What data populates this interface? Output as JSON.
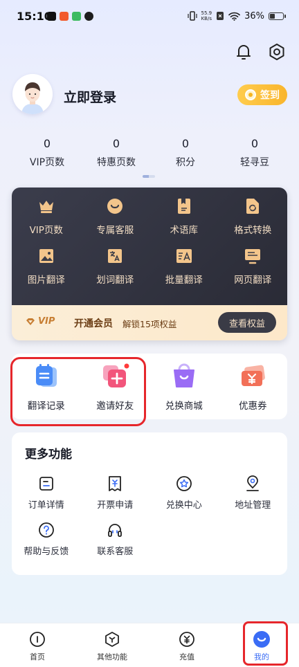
{
  "status_bar": {
    "time": "15:10",
    "net_speed_value": "55.9",
    "net_speed_unit": "KB/s",
    "battery": "36%",
    "battery_level": 0.36
  },
  "profile": {
    "login_label": "立即登录",
    "checkin_label": "签到"
  },
  "stats": [
    {
      "value": "0",
      "label": "VIP页数"
    },
    {
      "value": "0",
      "label": "特惠页数"
    },
    {
      "value": "0",
      "label": "积分"
    },
    {
      "value": "0",
      "label": "轻寻豆"
    }
  ],
  "vip_grid": [
    {
      "label": "VIP页数",
      "icon": "crown-icon"
    },
    {
      "label": "专属客服",
      "icon": "service-icon"
    },
    {
      "label": "术语库",
      "icon": "book-icon"
    },
    {
      "label": "格式转换",
      "icon": "convert-icon"
    },
    {
      "label": "图片翻译",
      "icon": "image-icon"
    },
    {
      "label": "划词翻译",
      "icon": "text-translate-icon"
    },
    {
      "label": "批量翻译",
      "icon": "batch-icon"
    },
    {
      "label": "网页翻译",
      "icon": "webpage-icon"
    }
  ],
  "vip_bar": {
    "badge": "VIP",
    "title": "开通会员",
    "subtitle": "解锁15项权益",
    "button": "查看权益"
  },
  "quick_tools": [
    {
      "label": "翻译记录",
      "icon": "record-icon",
      "color": "#4a8cf7"
    },
    {
      "label": "邀请好友",
      "icon": "invite-icon",
      "color": "#f2557b"
    },
    {
      "label": "兑换商城",
      "icon": "shop-icon",
      "color": "#9a6cf5"
    },
    {
      "label": "优惠券",
      "icon": "coupon-icon",
      "color": "#f27058"
    }
  ],
  "more": {
    "title": "更多功能",
    "items": [
      {
        "label": "订单详情",
        "icon": "order-icon"
      },
      {
        "label": "开票申请",
        "icon": "invoice-icon"
      },
      {
        "label": "兑换中心",
        "icon": "exchange-icon"
      },
      {
        "label": "地址管理",
        "icon": "location-icon"
      },
      {
        "label": "帮助与反馈",
        "icon": "help-icon"
      },
      {
        "label": "联系客服",
        "icon": "headset-icon"
      }
    ]
  },
  "nav": [
    {
      "label": "首页",
      "icon": "home-icon"
    },
    {
      "label": "其他功能",
      "icon": "features-icon"
    },
    {
      "label": "充值",
      "icon": "recharge-icon"
    },
    {
      "label": "我的",
      "icon": "mine-icon",
      "active": true
    }
  ],
  "colors": {
    "accent": "#3a6cf5",
    "vip_gold": "#f2c38a",
    "highlight_border": "#e6262b"
  }
}
